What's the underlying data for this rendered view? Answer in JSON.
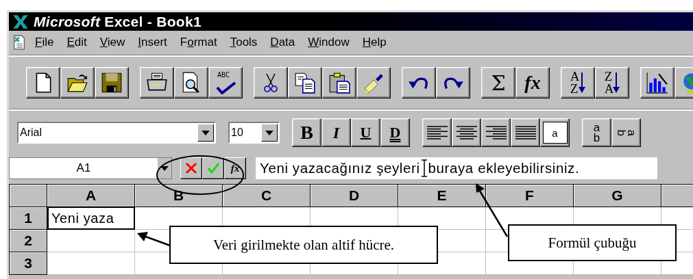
{
  "window": {
    "title": "*Microsoft* Excel - Book1"
  },
  "menu": [
    {
      "key": "F",
      "rest": "ile"
    },
    {
      "key": "E",
      "rest": "dit"
    },
    {
      "key": "V",
      "rest": "iew"
    },
    {
      "key": "I",
      "rest": "nsert"
    },
    {
      "start": "F",
      "key": "o",
      "rest": "rmat"
    },
    {
      "key": "T",
      "rest": "ools"
    },
    {
      "key": "D",
      "rest": "ata"
    },
    {
      "key": "W",
      "rest": "indow"
    },
    {
      "key": "H",
      "rest": "elp"
    }
  ],
  "standard_toolbar": [
    [
      {
        "kind": "new"
      },
      {
        "kind": "open"
      },
      {
        "kind": "save"
      }
    ],
    [
      {
        "kind": "print"
      },
      {
        "kind": "preview"
      },
      {
        "kind": "spell",
        "glyph": "ABC"
      }
    ],
    [
      {
        "kind": "cut"
      },
      {
        "kind": "copy"
      },
      {
        "kind": "paste"
      },
      {
        "kind": "painter"
      }
    ],
    [
      {
        "kind": "undo"
      },
      {
        "kind": "redo"
      }
    ],
    [
      {
        "kind": "sum",
        "glyph": "Σ"
      },
      {
        "kind": "function",
        "glyph": "fx"
      }
    ],
    [
      {
        "kind": "sort_asc",
        "glyph": "AZ"
      },
      {
        "kind": "sort_desc",
        "glyph": "ZA"
      }
    ],
    [
      {
        "kind": "chart"
      },
      {
        "kind": "globe"
      }
    ]
  ],
  "formatting_toolbar": {
    "font": "Arial",
    "size": "10",
    "groups": [
      [
        {
          "kind": "bold",
          "glyph": "B"
        },
        {
          "kind": "italic",
          "glyph": "I"
        },
        {
          "kind": "underline",
          "glyph": "U"
        },
        {
          "kind": "double_underline",
          "glyph": "D"
        }
      ],
      [
        {
          "kind": "align_left"
        },
        {
          "kind": "align_center"
        },
        {
          "kind": "align_right"
        },
        {
          "kind": "justify"
        },
        {
          "kind": "merge",
          "glyph": "a"
        }
      ],
      [
        {
          "kind": "vertical_text",
          "glyph": "ab"
        },
        {
          "kind": "rotated_text",
          "glyph": "ab"
        }
      ]
    ]
  },
  "formula_bar": {
    "name_box": "A1",
    "text_before_cursor": "Yeni yazacağınız şeyleri",
    "text_after_cursor": "buraya ekleyebilirsiniz.",
    "function_glyph": "fx"
  },
  "sheet": {
    "columns": [
      "A",
      "B",
      "C",
      "D",
      "E",
      "F",
      "G",
      ""
    ],
    "rows": [
      {
        "header": "1",
        "cells": [
          {
            "text": "Yeni yaza",
            "active": true
          },
          {
            "active": false
          },
          {
            "active": false
          },
          {
            "active": false
          },
          {
            "active": false
          },
          {
            "active": false
          },
          {
            "active": false
          },
          {
            "active": false
          }
        ]
      },
      {
        "header": "2",
        "cells": [
          {
            "active": false
          },
          {
            "active": false
          },
          {},
          {},
          {
            "active": false
          },
          {
            "active": false
          },
          {},
          {
            "active": false
          }
        ]
      },
      {
        "header": "3",
        "cells": [
          {
            "active": false
          },
          {
            "active": false
          },
          {
            "active": false
          },
          {
            "active": false
          },
          {
            "active": false
          },
          {
            "active": false
          },
          {
            "active": false
          },
          {
            "active": false
          }
        ]
      }
    ]
  },
  "annotations": [
    {
      "kind": "active_cell",
      "text": "Veri girilmekte olan altif hücre."
    },
    {
      "kind": "formula_bar",
      "text": "Formül çubuğu"
    }
  ]
}
